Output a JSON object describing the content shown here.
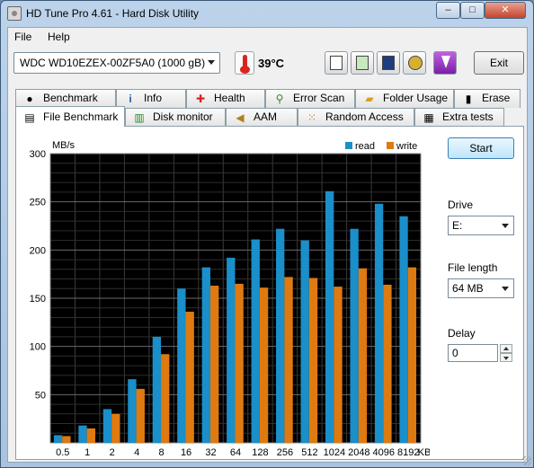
{
  "window": {
    "title": "HD Tune Pro 4.61 - Hard Disk Utility",
    "minimize_symbol": "–",
    "maximize_symbol": "□",
    "close_symbol": "✕"
  },
  "menu": [
    {
      "label": "File"
    },
    {
      "label": "Help"
    }
  ],
  "toolbar": {
    "drive": "WDC WD10EZEX-00ZF5A0     (1000 gB)",
    "temperature": "39°C",
    "icons": [
      "copy-info-icon",
      "copy-screenshot-icon",
      "save-icon",
      "options-icon",
      "download-icon"
    ],
    "exit_label": "Exit"
  },
  "tabs_row1": [
    {
      "label": "Benchmark",
      "icon": "benchmark-icon"
    },
    {
      "label": "Info",
      "icon": "info-icon"
    },
    {
      "label": "Health",
      "icon": "health-icon"
    },
    {
      "label": "Error Scan",
      "icon": "error-scan-icon"
    },
    {
      "label": "Folder Usage",
      "icon": "folder-icon"
    },
    {
      "label": "Erase",
      "icon": "erase-icon"
    }
  ],
  "tabs_row2": [
    {
      "label": "File Benchmark",
      "icon": "file-benchmark-icon",
      "active": true
    },
    {
      "label": "Disk monitor",
      "icon": "disk-monitor-icon"
    },
    {
      "label": "AAM",
      "icon": "speaker-icon"
    },
    {
      "label": "Random Access",
      "icon": "random-access-icon"
    },
    {
      "label": "Extra tests",
      "icon": "extra-tests-icon"
    }
  ],
  "side": {
    "start_label": "Start",
    "drive_label": "Drive",
    "drive_value": "E:",
    "file_length_label": "File length",
    "file_length_value": "64 MB",
    "delay_label": "Delay",
    "delay_value": "0"
  },
  "chart_data": {
    "type": "bar",
    "ylabel": "MB/s",
    "xlabel": "KB",
    "ylim": [
      0,
      300
    ],
    "yticks": [
      50,
      100,
      150,
      200,
      250,
      300
    ],
    "categories": [
      "0.5",
      "1",
      "2",
      "4",
      "8",
      "16",
      "32",
      "64",
      "128",
      "256",
      "512",
      "1024",
      "2048",
      "4096",
      "8192"
    ],
    "series": [
      {
        "name": "read",
        "color": "#1a8fc9",
        "values": [
          8,
          18,
          35,
          66,
          110,
          160,
          182,
          192,
          211,
          222,
          210,
          261,
          222,
          248,
          235
        ]
      },
      {
        "name": "write",
        "color": "#de7a10",
        "values": [
          7,
          15,
          30,
          56,
          92,
          136,
          163,
          165,
          161,
          172,
          171,
          162,
          181,
          164,
          182
        ]
      }
    ],
    "legend_position": "top-right",
    "background": "#000000",
    "grid": true
  }
}
